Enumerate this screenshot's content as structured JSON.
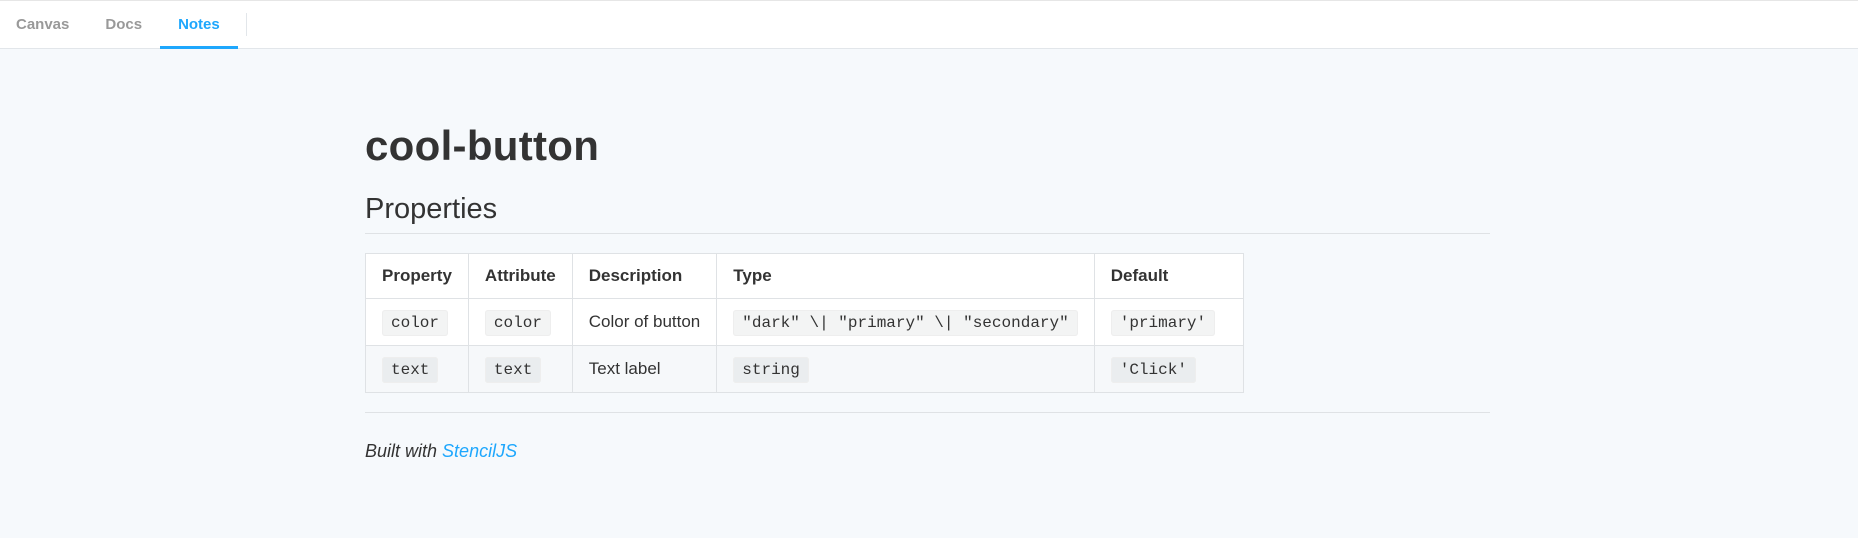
{
  "tabs": [
    {
      "label": "Canvas",
      "active": false
    },
    {
      "label": "Docs",
      "active": false
    },
    {
      "label": "Notes",
      "active": true
    }
  ],
  "page": {
    "title": "cool-button",
    "section_title": "Properties"
  },
  "table": {
    "headers": [
      "Property",
      "Attribute",
      "Description",
      "Type",
      "Default"
    ],
    "rows": [
      {
        "property": "color",
        "attribute": "color",
        "description": "Color of button",
        "type": "\"dark\" \\| \"primary\" \\| \"secondary\"",
        "default": "'primary'"
      },
      {
        "property": "text",
        "attribute": "text",
        "description": "Text label",
        "type": "string",
        "default": "'Click'"
      }
    ]
  },
  "footer": {
    "prefix": "Built with",
    "link_text": "StencilJS"
  },
  "colors": {
    "accent": "#1ea7fd",
    "background": "#f6f9fc",
    "text": "#333333"
  }
}
